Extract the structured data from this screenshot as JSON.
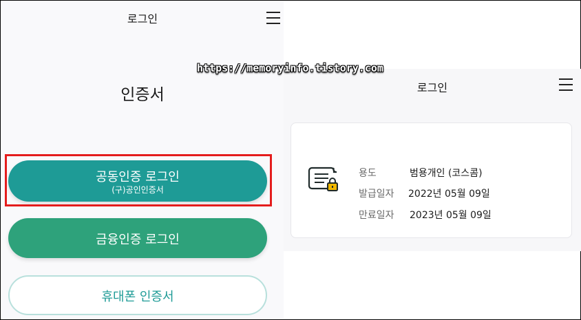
{
  "left_screen": {
    "header_title": "로그인",
    "section_title": "인증서",
    "buttons": {
      "joint_main": "공동인증 로그인",
      "joint_sub": "(구)공인인증서",
      "finance": "금융인증 로그인",
      "phone": "휴대폰 인증서"
    }
  },
  "watermark": "https://memoryinfo.tistory.com",
  "right_screen": {
    "header_title": "로그인",
    "certificate": {
      "usage_label": "용도",
      "usage_value": "범용개인 (코스콤)",
      "issue_label": "발급일자",
      "issue_value": "2022년 05월 09일",
      "expire_label": "만료일자",
      "expire_value": "2023년 05월 09일"
    }
  },
  "colors": {
    "joint_button": "#1e9b96",
    "finance_button": "#2ea27b",
    "highlight": "#e41c1c"
  }
}
